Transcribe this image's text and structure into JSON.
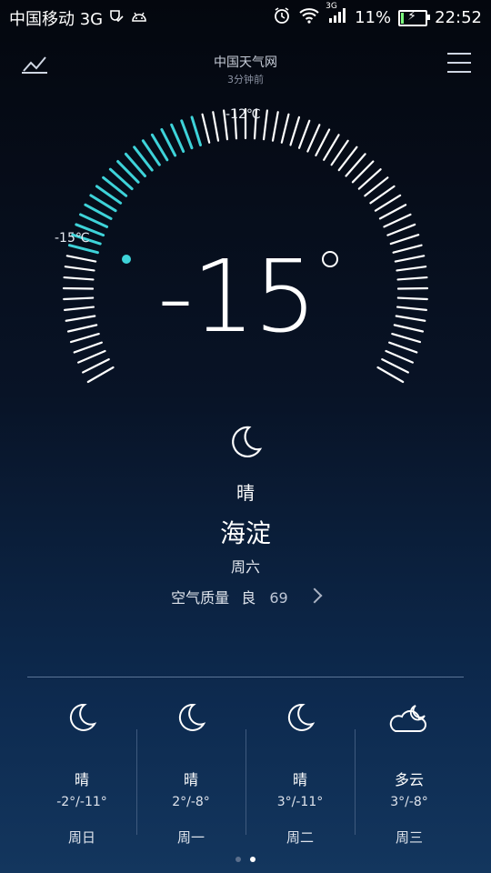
{
  "status_bar": {
    "carrier": "中国移动 3G",
    "network_badge": "3G",
    "battery_percent": "11%",
    "battery_level": 0.11,
    "time": "22:52",
    "icons": [
      "shield-check-icon",
      "android-icon",
      "alarm-icon",
      "wifi-icon",
      "signal-icon",
      "battery-charging-icon"
    ]
  },
  "header": {
    "source": "中国天气网",
    "updated": "3分钟前",
    "left_icon": "trend-chart-icon",
    "right_icon": "menu-icon"
  },
  "current": {
    "temperature": "-15",
    "max_label": "-12℃",
    "min_label": "-15℃",
    "condition": "晴",
    "city": "海淀",
    "weekday": "周六",
    "air_quality_label": "空气质量",
    "air_quality_level": "良",
    "air_quality_value": "69",
    "icon": "moon-icon",
    "accent_color": "#3ed3d9"
  },
  "forecast": [
    {
      "condition": "晴",
      "range": "-2°/-11°",
      "day": "周日",
      "icon": "moon-icon"
    },
    {
      "condition": "晴",
      "range": "2°/-8°",
      "day": "周一",
      "icon": "moon-icon"
    },
    {
      "condition": "晴",
      "range": "3°/-11°",
      "day": "周二",
      "icon": "moon-icon"
    },
    {
      "condition": "多云",
      "range": "3°/-8°",
      "day": "周三",
      "icon": "cloud-moon-icon"
    }
  ],
  "pager": {
    "pages": 2,
    "active": 2
  }
}
